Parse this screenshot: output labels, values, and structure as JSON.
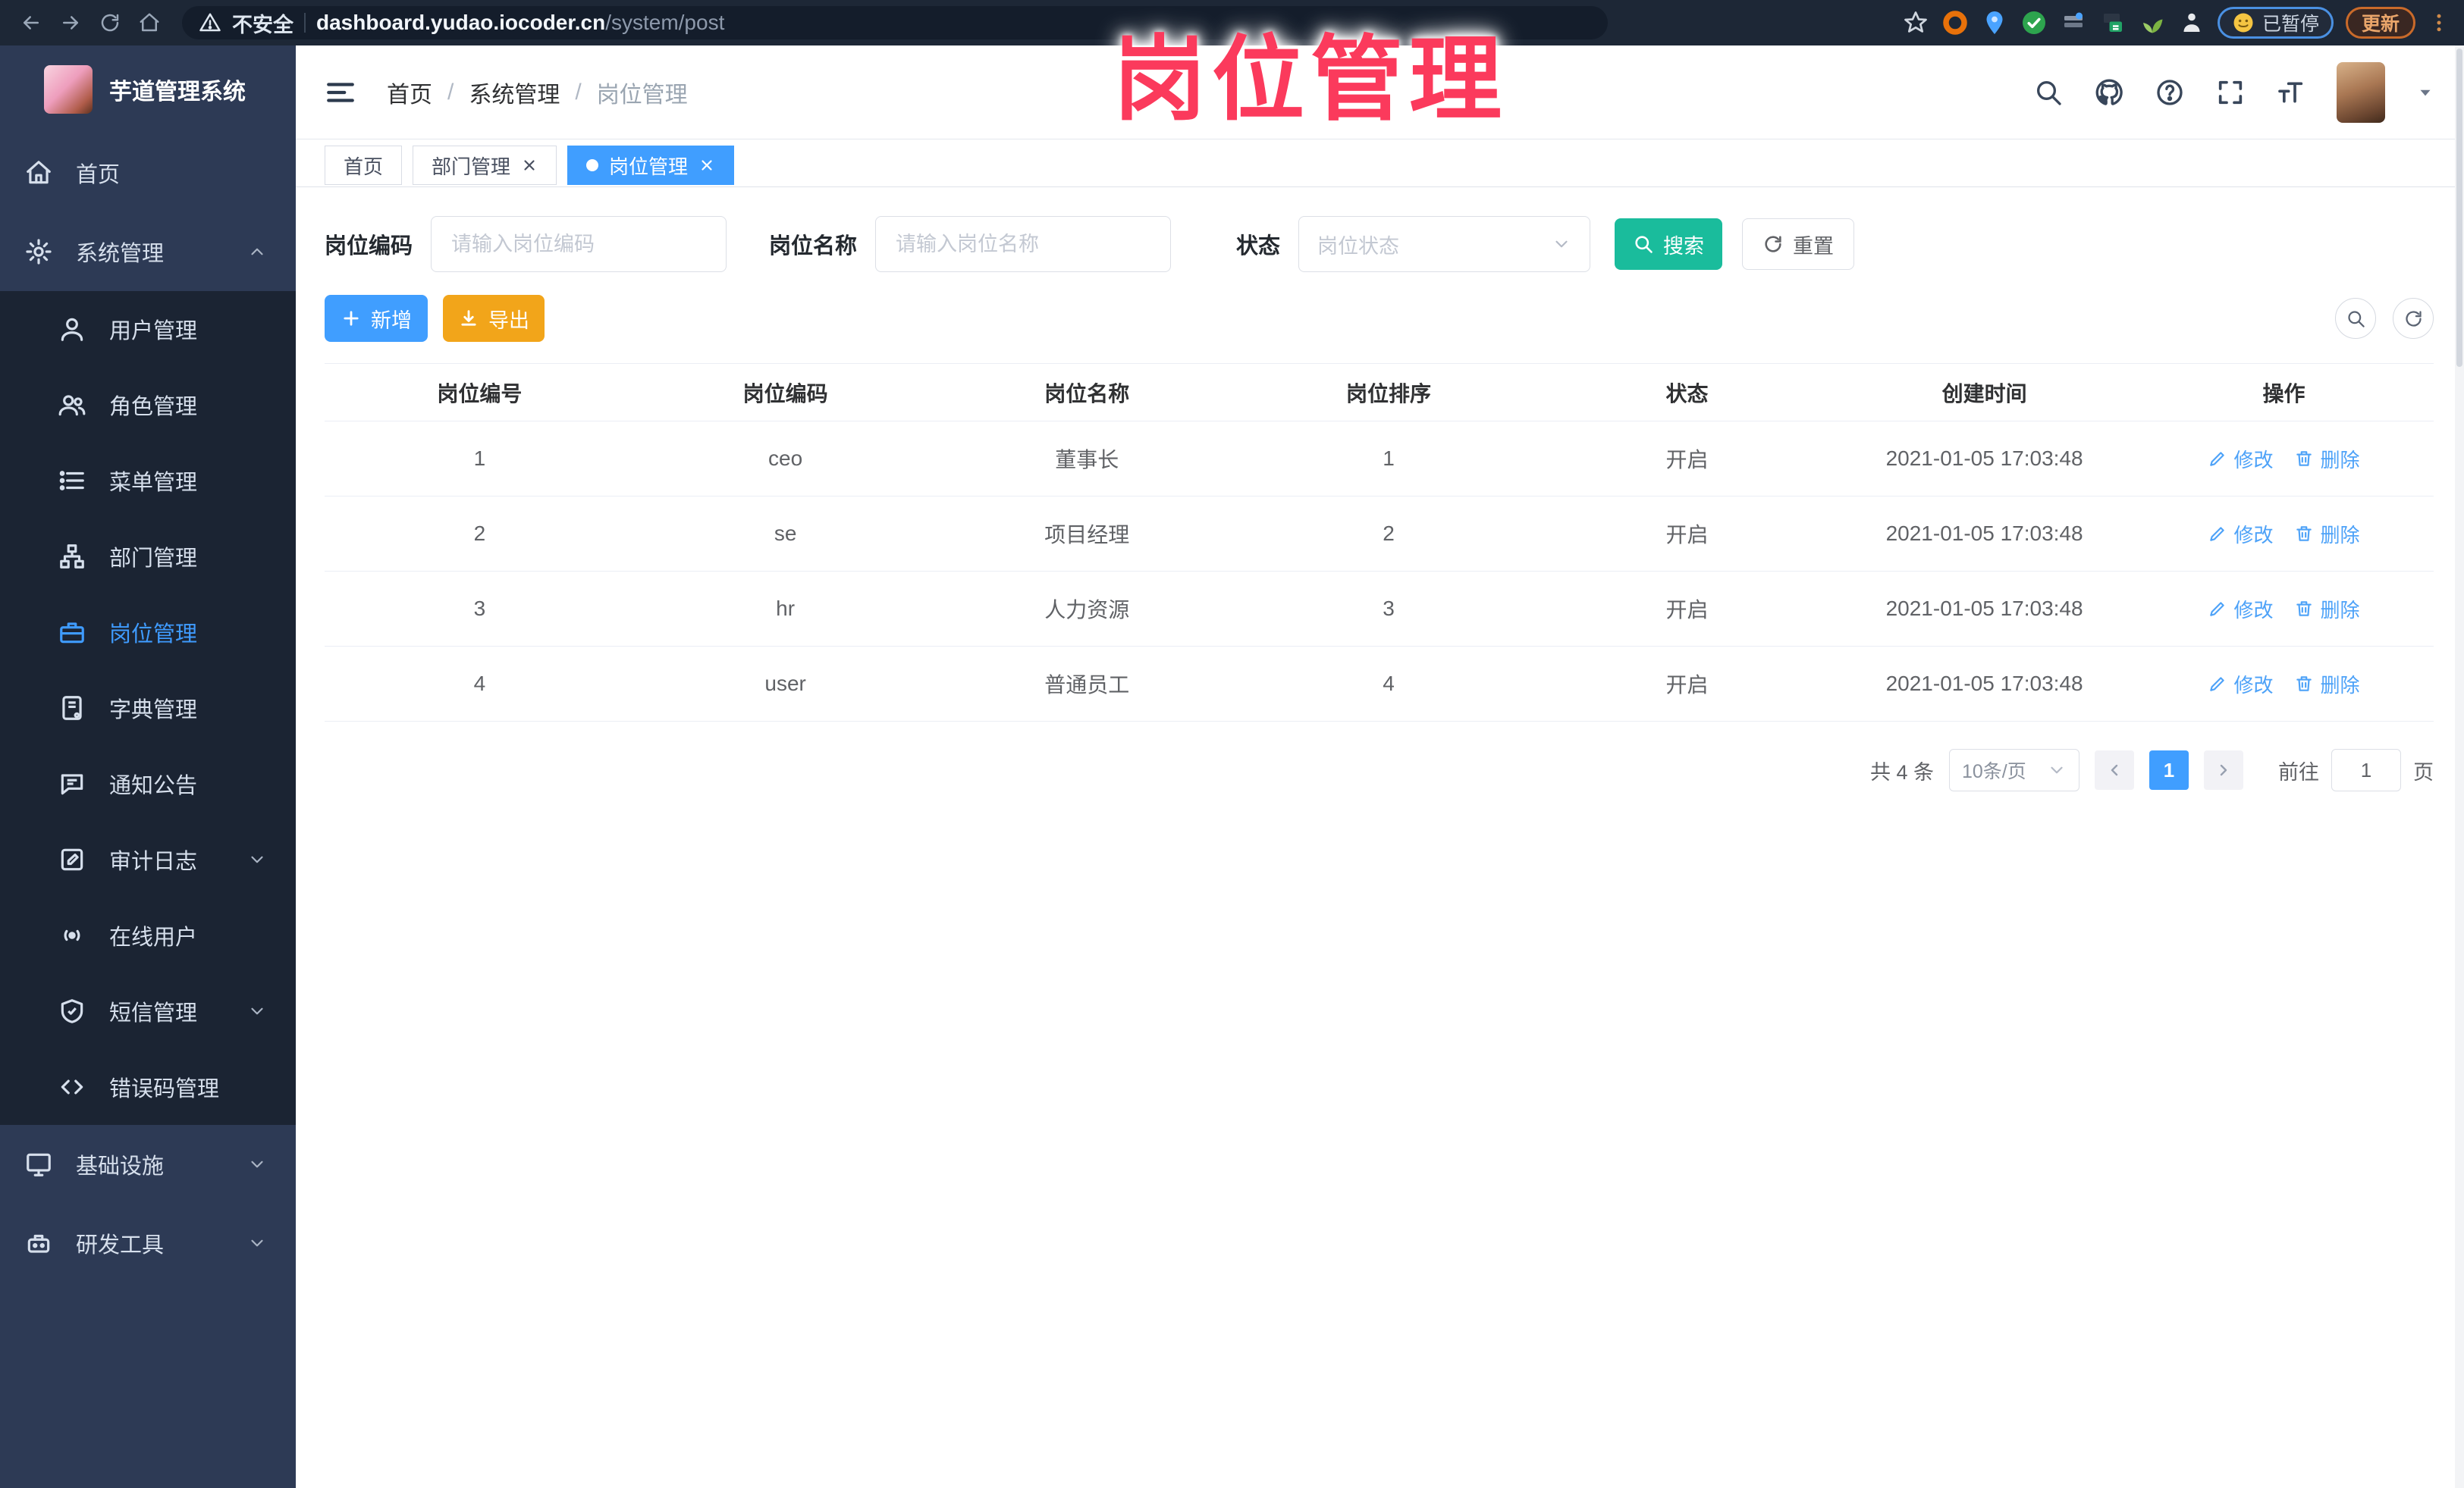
{
  "overlay": {
    "title": "岗位管理",
    "color": "#fb3a5c"
  },
  "browser": {
    "nav_icons": [
      "back-arrow",
      "forward-arrow",
      "reload",
      "home"
    ],
    "security_label": "不安全",
    "url_host": "dashboard.yudao.iocoder.cn",
    "url_path": "/system/post",
    "extension_icons": [
      "bookmark-star",
      "orange-ring",
      "blue-pin",
      "green-check",
      "gray-keyboard",
      "green-card",
      "green-sprout",
      "white-puzzle"
    ],
    "paused_label": "已暂停",
    "update_label": "更新"
  },
  "sidebar": {
    "app_title": "芋道管理系统",
    "items": [
      {
        "label": "首页",
        "icon": "home-icon"
      },
      {
        "label": "系统管理",
        "icon": "gear-icon",
        "arrow": "up"
      },
      {
        "label": "用户管理",
        "icon": "user-icon"
      },
      {
        "label": "角色管理",
        "icon": "users-icon"
      },
      {
        "label": "菜单管理",
        "icon": "menu-list-icon"
      },
      {
        "label": "部门管理",
        "icon": "org-tree-icon"
      },
      {
        "label": "岗位管理",
        "icon": "briefcase-icon",
        "active": true
      },
      {
        "label": "字典管理",
        "icon": "dictionary-icon"
      },
      {
        "label": "通知公告",
        "icon": "announcement-icon"
      },
      {
        "label": "审计日志",
        "icon": "audit-log-icon",
        "arrow": "down"
      },
      {
        "label": "在线用户",
        "icon": "online-users-icon"
      },
      {
        "label": "短信管理",
        "icon": "sms-shield-icon",
        "arrow": "down"
      },
      {
        "label": "错误码管理",
        "icon": "error-code-icon"
      },
      {
        "label": "基础设施",
        "icon": "infrastructure-icon",
        "arrow": "down"
      },
      {
        "label": "研发工具",
        "icon": "dev-tools-icon",
        "arrow": "down"
      }
    ]
  },
  "header": {
    "breadcrumb": [
      {
        "label": "首页"
      },
      {
        "label": "系统管理"
      },
      {
        "label": "岗位管理"
      }
    ],
    "breadcrumb_separator": "/",
    "icons": [
      "search-icon",
      "github-icon",
      "help-icon",
      "fullscreen-icon",
      "font-size-icon",
      "avatar",
      "caret-down-icon"
    ]
  },
  "tabs": [
    {
      "label": "首页"
    },
    {
      "label": "部门管理",
      "closable": true
    },
    {
      "label": "岗位管理",
      "closable": true,
      "active": true
    }
  ],
  "filters": {
    "post_code_label": "岗位编码",
    "post_code_placeholder": "请输入岗位编码",
    "post_name_label": "岗位名称",
    "post_name_placeholder": "请输入岗位名称",
    "status_label": "状态",
    "status_placeholder": "岗位状态",
    "search_label": "搜索",
    "reset_label": "重置"
  },
  "toolbar": {
    "add_label": "新增",
    "export_label": "导出"
  },
  "table": {
    "columns": [
      "岗位编号",
      "岗位编码",
      "岗位名称",
      "岗位排序",
      "状态",
      "创建时间",
      "操作"
    ],
    "rows": [
      {
        "id": "1",
        "code": "ceo",
        "name": "董事长",
        "sort": "1",
        "status": "开启",
        "created": "2021-01-05 17:03:48",
        "edit_label": "修改",
        "delete_label": "删除"
      },
      {
        "id": "2",
        "code": "se",
        "name": "项目经理",
        "sort": "2",
        "status": "开启",
        "created": "2021-01-05 17:03:48",
        "edit_label": "修改",
        "delete_label": "删除"
      },
      {
        "id": "3",
        "code": "hr",
        "name": "人力资源",
        "sort": "3",
        "status": "开启",
        "created": "2021-01-05 17:03:48",
        "edit_label": "修改",
        "delete_label": "删除"
      },
      {
        "id": "4",
        "code": "user",
        "name": "普通员工",
        "sort": "4",
        "status": "开启",
        "created": "2021-01-05 17:03:48",
        "edit_label": "修改",
        "delete_label": "删除"
      }
    ]
  },
  "pagination": {
    "total_label": "共 4 条",
    "page_size_label": "10条/页",
    "current_page": "1",
    "goto_label": "前往",
    "goto_value": "1",
    "page_unit_label": "页"
  },
  "colors": {
    "primary_blue": "#409eff",
    "search_teal": "#1abc9c",
    "export_orange": "#f2a51a",
    "overlay_pink": "#fb3a5c",
    "sidebar_bg": "#2d3a55",
    "submenu_bg": "#1b2433",
    "browser_bar_bg": "#1d2736"
  }
}
